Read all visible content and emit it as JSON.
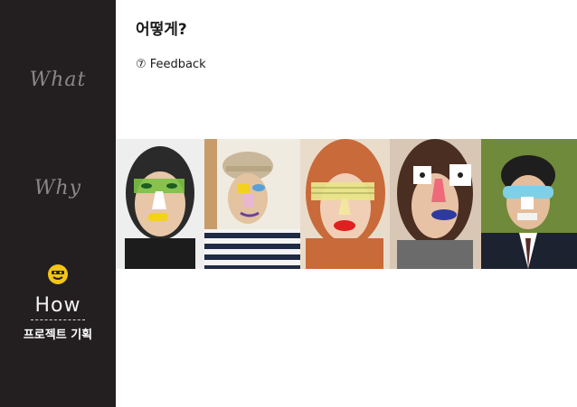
{
  "sidebar": {
    "items": [
      {
        "label": "What"
      },
      {
        "label": "Why"
      },
      {
        "label": "How",
        "sub": "프로젝트 기획"
      }
    ]
  },
  "main": {
    "title": "어떻게?",
    "section": "⑦ Feedback"
  },
  "photos": [
    {
      "name": "photo-1"
    },
    {
      "name": "photo-2"
    },
    {
      "name": "photo-3"
    },
    {
      "name": "photo-4"
    },
    {
      "name": "photo-5"
    }
  ],
  "colors": {
    "sidebar_bg": "#231f20",
    "sidebar_text_inactive": "#8a8788",
    "sidebar_text_active": "#f2f2f2",
    "badge": "#f3c515"
  }
}
